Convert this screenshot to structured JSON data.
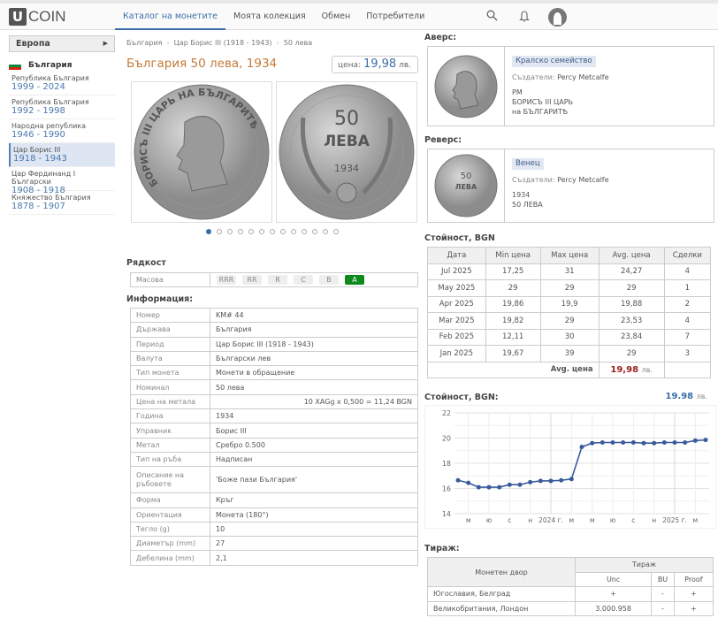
{
  "header": {
    "logo_letter": "U",
    "logo_text": "COIN",
    "nav": [
      "Каталог на монетите",
      "Моята колекция",
      "Обмен",
      "Потребители"
    ],
    "active_nav": 0,
    "icons": [
      "search-icon",
      "bell-icon",
      "avatar"
    ]
  },
  "sidebar": {
    "region": "Европа",
    "country": "България",
    "periods": [
      {
        "name": "Република България",
        "years": "1999 - 2024"
      },
      {
        "name": "Република България",
        "years": "1992 - 1998"
      },
      {
        "name": "Народна република",
        "years": "1946 - 1990"
      },
      {
        "name": "Цар Борис III",
        "years": "1918 - 1943",
        "selected": true
      },
      {
        "name": "Цар Фердинанд I Български",
        "years": "1908 - 1918"
      },
      {
        "name": "Княжество България",
        "years": "1878 - 1907"
      }
    ]
  },
  "breadcrumb": [
    "България",
    "Цар Борис III (1918 - 1943)",
    "50 лева"
  ],
  "title": "България 50 лева, 1934",
  "price": {
    "label": "цена:",
    "value": "19,98",
    "unit": "лв."
  },
  "gallery": {
    "obverse_text": "БОРИСЪ III ЦАРЬ НА БЪЛГАРИТѢ",
    "reverse_value": "50",
    "reverse_unit": "ЛЕВА",
    "reverse_year": "1934",
    "dots": 13,
    "active_dot": 0
  },
  "rarity": {
    "title": "Рядкост",
    "label": "Масова",
    "levels": [
      "RRR",
      "RR",
      "R",
      "C",
      "B",
      "A"
    ],
    "active": "A"
  },
  "info": {
    "title": "Информация:",
    "rows": [
      [
        "Номер",
        "KM# 44"
      ],
      [
        "Държава",
        "България"
      ],
      [
        "Период",
        "Цар Борис III (1918 - 1943)"
      ],
      [
        "Валута",
        "Български лев"
      ],
      [
        "Тип монета",
        "Монети в обращение"
      ],
      [
        "Номинал",
        "50 лева"
      ],
      [
        "Цена на метала",
        "10 XAGg x 0,500 = 11,24 BGN"
      ],
      [
        "Година",
        "1934"
      ],
      [
        "Управник",
        "Борис III"
      ],
      [
        "Метал",
        "Сребро 0.500"
      ],
      [
        "Тип на ръба",
        "Надписан"
      ],
      [
        "Описание на ръбовете",
        "'Боже пази България'"
      ],
      [
        "Форма",
        "Кръг"
      ],
      [
        "Ориентация",
        "Монета (180°)"
      ],
      [
        "Тегло (g)",
        "10"
      ],
      [
        "Диаметър (mm)",
        "27"
      ],
      [
        "Дебелина (mm)",
        "2,1"
      ]
    ]
  },
  "obverse": {
    "title": "Аверс:",
    "tag": "Кралско семейство",
    "creators_label": "Създатели:",
    "creators": "Percy Metcalfe",
    "lines": [
      "PM",
      "БОРИСЪ III ЦАРЬ",
      "на БЪЛГАРИТѢ"
    ]
  },
  "reverse": {
    "title": "Реверс:",
    "tag": "Венец",
    "creators_label": "Създатели:",
    "creators": "Percy Metcalfe",
    "lines": [
      "1934",
      "50 ЛЕВА"
    ]
  },
  "prices": {
    "title": "Стойност, BGN",
    "headers": [
      "Дата",
      "Min цена",
      "Max цена",
      "Avg. цена",
      "Сделки"
    ],
    "rows": [
      [
        "Jul 2025",
        "17,25",
        "31",
        "24,27",
        "4"
      ],
      [
        "May 2025",
        "29",
        "29",
        "29",
        "1"
      ],
      [
        "Apr 2025",
        "19,86",
        "19,9",
        "19,88",
        "2"
      ],
      [
        "Mar 2025",
        "19,82",
        "29",
        "23,53",
        "4"
      ],
      [
        "Feb 2025",
        "12,11",
        "30",
        "23,84",
        "7"
      ],
      [
        "Jan 2025",
        "19,67",
        "39",
        "29",
        "3"
      ]
    ],
    "avg_label": "Avg. цена",
    "avg_value": "19,98",
    "avg_unit": "лв."
  },
  "chart_data": {
    "type": "line",
    "title": "Стойност, BGN:",
    "current_value": "19.98",
    "current_unit": "лв.",
    "color": "#3a5a9c",
    "grid": true,
    "ylim": [
      14,
      22
    ],
    "yticks": [
      14,
      16,
      18,
      20,
      22
    ],
    "xtick_labels": [
      "м",
      "ю",
      "с",
      "н",
      "2024 г.",
      "м",
      "м",
      "ю",
      "с",
      "н",
      "2025 г.",
      "м"
    ],
    "values": [
      16.65,
      16.45,
      16.1,
      16.1,
      16.1,
      16.3,
      16.3,
      16.5,
      16.6,
      16.6,
      16.65,
      16.75,
      19.3,
      19.6,
      19.65,
      19.65,
      19.65,
      19.65,
      19.6,
      19.6,
      19.65,
      19.65,
      19.65,
      19.8,
      19.85
    ]
  },
  "mintage": {
    "title": "Тираж:",
    "col_mint": "Монетен двор",
    "col_group": "Тираж",
    "cols": [
      "Unc",
      "BU",
      "Proof"
    ],
    "rows": [
      [
        "Югославия, Белград",
        "+",
        "-",
        "+"
      ],
      [
        "Великобритания, Лондон",
        "3.000.958",
        "-",
        "+"
      ]
    ]
  }
}
